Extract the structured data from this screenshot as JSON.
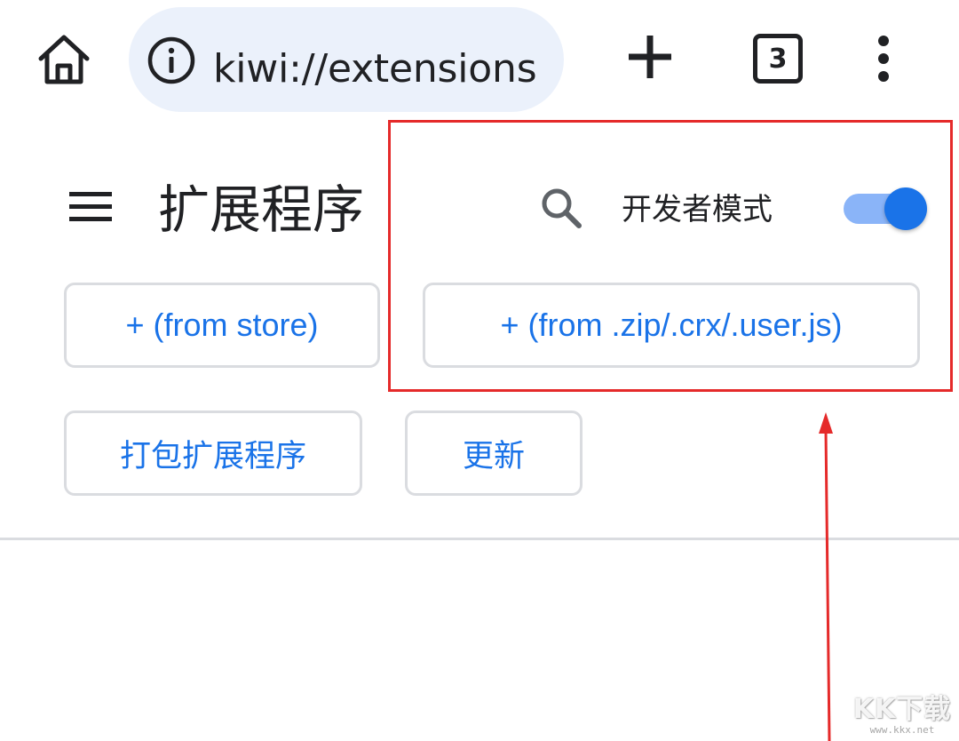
{
  "browser": {
    "url": "kiwi://extensions",
    "tab_count": "3"
  },
  "extensions_page": {
    "title": "扩展程序",
    "developer_mode_label": "开发者模式",
    "developer_mode_enabled": true,
    "buttons": {
      "from_store": "+ (from store)",
      "from_zip": "+ (from .zip/.crx/.user.js)",
      "pack": "打包扩展程序",
      "update": "更新"
    }
  },
  "annotation": {
    "highlight_color": "#e52a2a"
  },
  "watermark": {
    "logo": "KK下载",
    "url": "www.kkx.net"
  },
  "colors": {
    "accent": "#1a73e8",
    "toggle_track": "#8ab4f8",
    "omnibox_bg": "#ebf1fb"
  },
  "icons": [
    "home-icon",
    "info-icon",
    "plus-icon",
    "tab-switcher-icon",
    "more-vert-icon",
    "menu-icon",
    "search-icon"
  ]
}
